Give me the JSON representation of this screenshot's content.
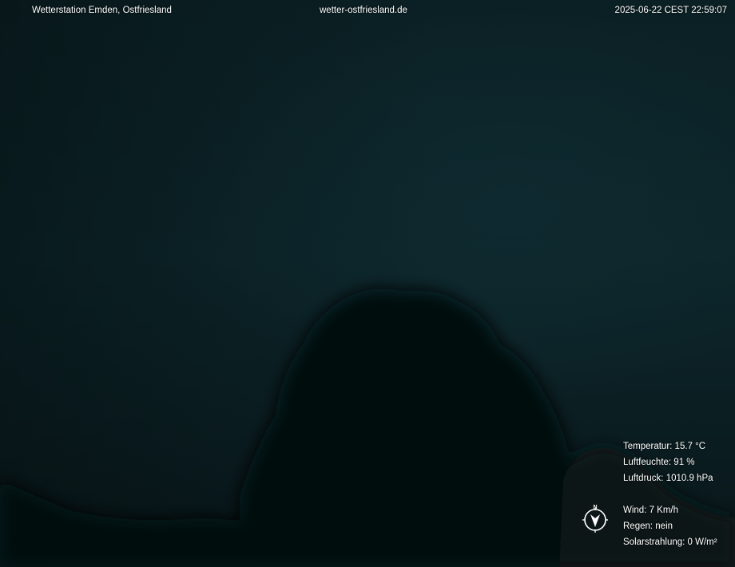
{
  "header": {
    "station": "Wetterstation Emden, Ostfriesland",
    "website": "wetter-ostfriesland.de",
    "timestamp": "2025-06-22 CEST 22:59:07"
  },
  "weather": {
    "temperature": "Temperatur: 15.7 °C",
    "humidity": "Luftfeuchte: 91 %",
    "pressure": "Luftdruck: 1010.9 hPa",
    "wind": "Wind: 7 Km/h",
    "rain": "Regen: nein",
    "solar": "Solarstrahlung: 0 W/m²"
  },
  "compass": {
    "north_label": "N",
    "icon": "wind-direction-compass-icon"
  },
  "colors": {
    "sky": "#0d262b",
    "tree_silhouette": "#050d0f",
    "text": "#ffffff"
  }
}
